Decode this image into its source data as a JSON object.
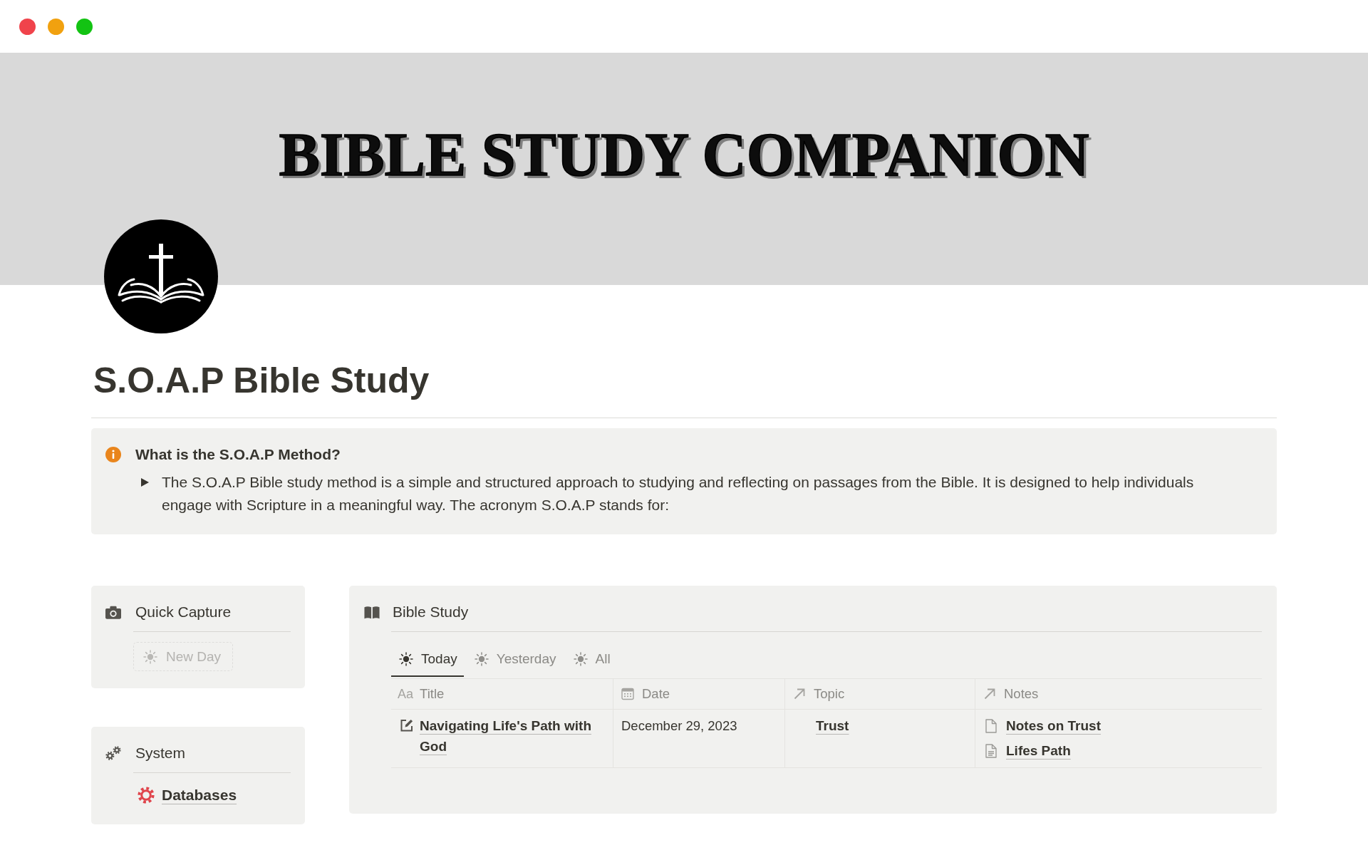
{
  "banner": {
    "title": "BIBLE STUDY COMPANION"
  },
  "page": {
    "title": "S.O.A.P Bible Study"
  },
  "callout": {
    "heading": "What is the S.O.A.P Method?",
    "toggle": {
      "expanded": false,
      "text": "The S.O.A.P Bible study method is a simple and structured approach to studying and reflecting on passages from the Bible. It is designed to help individuals engage with Scripture in a meaningful way. The acronym S.O.A.P stands for:"
    }
  },
  "quick_capture": {
    "title": "Quick Capture",
    "buttons": [
      {
        "label": "New Day",
        "disabled": true
      }
    ]
  },
  "system": {
    "title": "System",
    "links": [
      {
        "label": "Databases"
      }
    ]
  },
  "bible_study": {
    "title": "Bible Study",
    "tabs": [
      {
        "label": "Today",
        "selected": true
      },
      {
        "label": "Yesterday",
        "selected": false
      },
      {
        "label": "All",
        "selected": false
      }
    ],
    "table": {
      "columns": [
        {
          "label": "Title",
          "kind": "title",
          "icon_text": "Aa"
        },
        {
          "label": "Date",
          "kind": "date"
        },
        {
          "label": "Topic",
          "kind": "relation"
        },
        {
          "label": "Notes",
          "kind": "relation"
        }
      ],
      "rows": [
        {
          "title": "Navigating Life's Path with God",
          "date": "December 29, 2023",
          "topic": [
            {
              "label": "Trust"
            }
          ],
          "notes": [
            {
              "label": "Notes on Trust",
              "kind": "page"
            },
            {
              "label": "Lifes Path",
              "kind": "document"
            }
          ]
        }
      ]
    }
  }
}
